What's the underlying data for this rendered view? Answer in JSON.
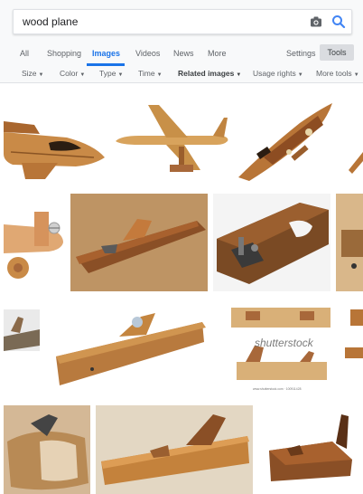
{
  "search": {
    "query": "wood plane",
    "camera_icon": "camera-icon",
    "search_icon": "search-icon"
  },
  "tabs": [
    {
      "label": "All"
    },
    {
      "label": "Shopping"
    },
    {
      "label": "Images"
    },
    {
      "label": "Videos"
    },
    {
      "label": "News"
    },
    {
      "label": "More"
    }
  ],
  "settings_label": "Settings",
  "tools_label": "Tools",
  "filters": [
    {
      "label": "Size"
    },
    {
      "label": "Color"
    },
    {
      "label": "Type"
    },
    {
      "label": "Time"
    },
    {
      "label": "Related images"
    },
    {
      "label": "Usage rights"
    },
    {
      "label": "More tools"
    }
  ],
  "images": {
    "watermark": "shutterstock",
    "watermark_small": "www.shutterstock.com · 100911428"
  },
  "colors": {
    "accent": "#1a73e8",
    "wood_light": "#d9a35f",
    "wood_mid": "#b8743a",
    "wood_dark": "#7a4a24"
  }
}
